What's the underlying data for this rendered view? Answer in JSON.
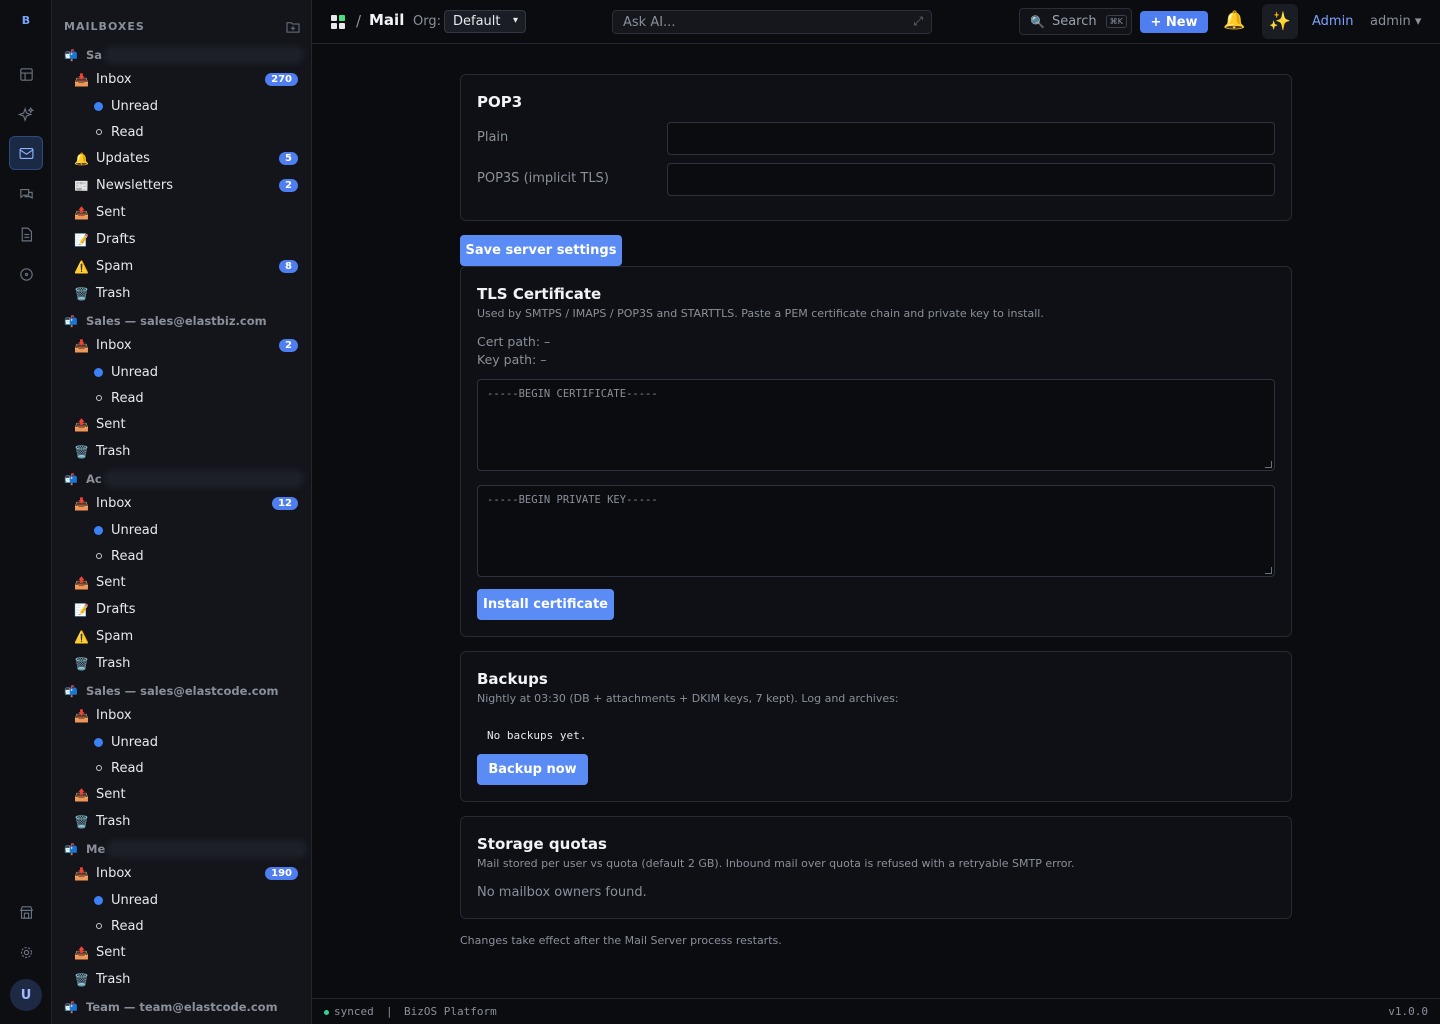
{
  "rail": {
    "logo": "B",
    "items": [
      {
        "name": "table-icon"
      },
      {
        "name": "sparkles-icon"
      },
      {
        "name": "mail-icon",
        "active": true
      },
      {
        "name": "chat-icon"
      },
      {
        "name": "document-icon"
      },
      {
        "name": "compass-icon"
      }
    ],
    "bottom": [
      {
        "name": "store-icon"
      },
      {
        "name": "gear-icon"
      }
    ],
    "avatar": "U"
  },
  "sidebar": {
    "title": "MAILBOXES",
    "accounts": [
      {
        "label": "Sa",
        "blurred": true,
        "folders": [
          {
            "label": "Inbox",
            "icon": "📥",
            "badge": "270",
            "subs": [
              {
                "label": "Unread",
                "kind": "dot"
              },
              {
                "label": "Read",
                "kind": "ring"
              }
            ]
          },
          {
            "label": "Updates",
            "icon": "🔔",
            "badge": "5"
          },
          {
            "label": "Newsletters",
            "icon": "📰",
            "badge": "2"
          },
          {
            "label": "Sent",
            "icon": "📤"
          },
          {
            "label": "Drafts",
            "icon": "📝"
          },
          {
            "label": "Spam",
            "icon": "⚠️",
            "badge": "8"
          },
          {
            "label": "Trash",
            "icon": "🗑️"
          }
        ]
      },
      {
        "label": "Sales — sales@elastbiz.com",
        "folders": [
          {
            "label": "Inbox",
            "icon": "📥",
            "badge": "2",
            "subs": [
              {
                "label": "Unread",
                "kind": "dot"
              },
              {
                "label": "Read",
                "kind": "ring"
              }
            ]
          },
          {
            "label": "Sent",
            "icon": "📤"
          },
          {
            "label": "Trash",
            "icon": "🗑️"
          }
        ]
      },
      {
        "label": "Ac",
        "blurred": true,
        "folders": [
          {
            "label": "Inbox",
            "icon": "📥",
            "badge": "12",
            "subs": [
              {
                "label": "Unread",
                "kind": "dot"
              },
              {
                "label": "Read",
                "kind": "ring"
              }
            ]
          },
          {
            "label": "Sent",
            "icon": "📤"
          },
          {
            "label": "Drafts",
            "icon": "📝"
          },
          {
            "label": "Spam",
            "icon": "⚠️"
          },
          {
            "label": "Trash",
            "icon": "🗑️"
          }
        ]
      },
      {
        "label": "Sales — sales@elastcode.com",
        "folders": [
          {
            "label": "Inbox",
            "icon": "📥",
            "subs": [
              {
                "label": "Unread",
                "kind": "dot"
              },
              {
                "label": "Read",
                "kind": "ring"
              }
            ]
          },
          {
            "label": "Sent",
            "icon": "📤"
          },
          {
            "label": "Trash",
            "icon": "🗑️"
          }
        ]
      },
      {
        "label": "Me",
        "blurred": true,
        "folders": [
          {
            "label": "Inbox",
            "icon": "📥",
            "badge": "190",
            "subs": [
              {
                "label": "Unread",
                "kind": "dot"
              },
              {
                "label": "Read",
                "kind": "ring"
              }
            ]
          },
          {
            "label": "Sent",
            "icon": "📤"
          },
          {
            "label": "Trash",
            "icon": "🗑️"
          }
        ]
      },
      {
        "label": "Team — team@elastcode.com",
        "folders": []
      }
    ]
  },
  "topbar": {
    "sep": "/",
    "title": "Mail",
    "org_label": "Org:",
    "org_value": "Default",
    "ask_placeholder": "Ask AI...",
    "search_label": "Search",
    "search_kbd": "⌘K",
    "new_label": "+ New",
    "admin_label": "Admin",
    "user_label": "admin ▾"
  },
  "pop3": {
    "title": "POP3",
    "plain_label": "Plain",
    "pop3s_label": "POP3S (implicit TLS)"
  },
  "save_button": "Save server settings",
  "tls": {
    "title": "TLS Certificate",
    "desc": "Used by SMTPS / IMAPS / POP3S and STARTTLS. Paste a PEM certificate chain and private key to install.",
    "cert_path": "Cert path: –",
    "key_path": "Key path: –",
    "cert_placeholder": "-----BEGIN CERTIFICATE-----",
    "key_placeholder": "-----BEGIN PRIVATE KEY-----",
    "install_button": "Install certificate"
  },
  "backups": {
    "title": "Backups",
    "desc": "Nightly at 03:30 (DB + attachments + DKIM keys, 7 kept). Log and archives:",
    "log": "No backups yet.",
    "button": "Backup now"
  },
  "quotas": {
    "title": "Storage quotas",
    "desc": "Mail stored per user vs quota (default 2 GB). Inbound mail over quota is refused with a retryable SMTP error.",
    "empty": "No mailbox owners found."
  },
  "footnote": "Changes take effect after the Mail Server process restarts.",
  "status": {
    "synced": "synced",
    "sep": "|",
    "platform": "BizOS Platform",
    "version": "v1.0.0"
  }
}
